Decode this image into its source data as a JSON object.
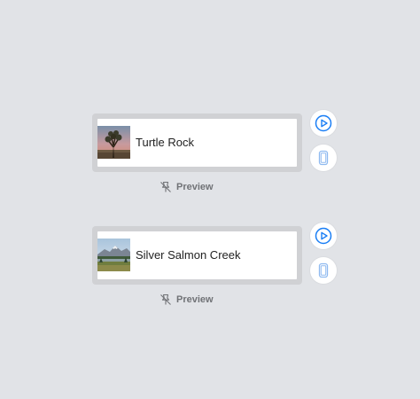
{
  "previews": [
    {
      "label": "Turtle Rock",
      "thumbnail": "joshua-tree-photo",
      "caption": "Preview",
      "icons": {
        "play": "play-circle-icon",
        "device": "device-icon",
        "caption": "preview-pin-slash-icon"
      }
    },
    {
      "label": "Silver Salmon Creek",
      "thumbnail": "mountain-lake-photo",
      "caption": "Preview",
      "icons": {
        "play": "play-circle-icon",
        "device": "device-icon",
        "caption": "preview-pin-slash-icon"
      }
    }
  ],
  "colors": {
    "canvas": "#e1e3e7",
    "frame": "#d0d1d4",
    "accent": "#1a7ef5",
    "caption": "#707276"
  }
}
